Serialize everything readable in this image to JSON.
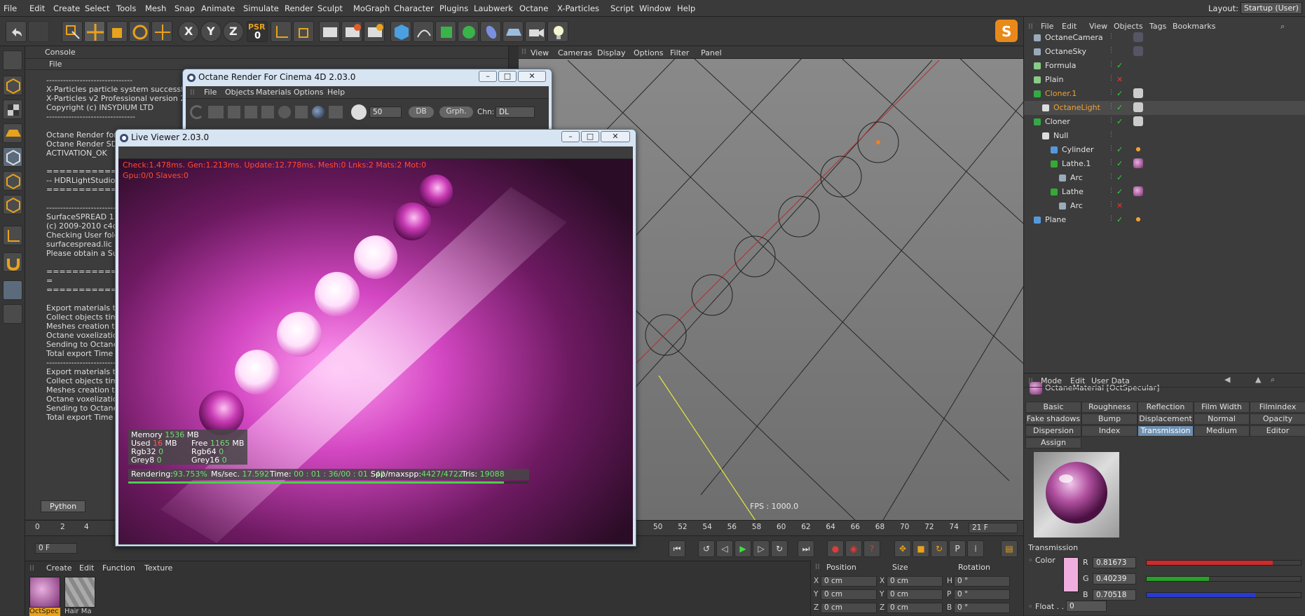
{
  "menubar": {
    "items": [
      "File",
      "Edit",
      "Create",
      "Select",
      "Tools",
      "Mesh",
      "Snap",
      "Animate",
      "Simulate",
      "Render",
      "Sculpt",
      "MoGraph",
      "Character",
      "Plugins",
      "Laubwerk",
      "Octane",
      "X-Particles",
      "Script",
      "Window",
      "Help"
    ],
    "layout_label": "Layout:",
    "layout_value": "Startup (User)"
  },
  "toolbar": {
    "x_label": "X",
    "y_label": "Y",
    "z_label": "Z",
    "psr_label": "PSR",
    "psr_value": "0"
  },
  "console": {
    "title": "Console",
    "file_menu": "File",
    "log": "-------------------------------\nX-Particles particle system successfully\nX-Particles v2 Professional version 2.5\nCopyright (c) INSYDIUM LTD\n--------------------------------\n\nOctane Render for\nOctane Render SD\nACTIVATION_OK\n\n================\n-- HDRLightStudio\n================\n\n--------------------------------\nSurfaceSPREAD 1.0\n(c) 2009-2010 c4d-\nChecking User fold\nsurfacespread.lic c\nPlease obtain a Su\n\n================\n=\n================\n\nExport materials tim\nCollect objects tim\nMeshes creation ti\nOctane voxelizatio\nSending to Octane\nTotal export Time =\n--------------------------------\nExport materials tim\nCollect objects tim\nMeshes creation ti\nOctane voxelizatio\nSending to Octane\nTotal export Time =",
    "python_button": "Python"
  },
  "octane_window": {
    "title": "Octane Render For Cinema 4D 2.03.0",
    "menu": [
      "File",
      "Objects",
      "Materials",
      "Options",
      "Help"
    ],
    "spp_value": "50",
    "db_button": "DB",
    "graph_button": "Grph.",
    "channel_label": "Chn:",
    "channel_value": "DL"
  },
  "live_viewer": {
    "title": "Live Viewer 2.03.0",
    "status_line1": "Check:1.478ms. Gen:1.213ms. Update:12.778ms. Mesh:0 Lnks:2 Mats:2 Mot:0",
    "status_line2": "Gpu:0/0 Slaves:0",
    "memory_label": "Memory",
    "memory_value": "1536",
    "memory_unit": "MB",
    "used_label": "Used",
    "used_value": "16",
    "used_unit": "MB",
    "free_label": "Free",
    "free_value": "1165",
    "free_unit": "MB",
    "rgb32_label": "Rgb32",
    "rgb32_value": "0",
    "rgb64_label": "Rgb64",
    "rgb64_value": "0",
    "grey8_label": "Grey8",
    "grey8_value": "0",
    "grey16_label": "Grey16",
    "grey16_value": "0",
    "rendering_label": "Rendering:",
    "rendering_value": "93.753%",
    "mssec_label": "Ms/sec.",
    "mssec_value": "17.592",
    "time_label": "Time:",
    "time_value": "00 : 01 : 36/00 : 01 : 42",
    "spp_label": "Spp/maxspp:",
    "spp_value": "4427/4722",
    "tris_label": "Tris:",
    "tris_value": "19088",
    "progress": 0.9375
  },
  "viewport": {
    "menu": [
      "View",
      "Cameras",
      "Display",
      "Options",
      "Filter",
      "Panel"
    ],
    "fps": "FPS : 1000.0"
  },
  "timeline": {
    "ticks_left": [
      "0",
      "2",
      "4"
    ],
    "ticks_right": [
      "50",
      "52",
      "54",
      "56",
      "58",
      "60",
      "62",
      "64",
      "66",
      "68",
      "70",
      "72",
      "74"
    ],
    "current_frame": "21 F",
    "start_field": "0 F",
    "start_field2": "0 F"
  },
  "material_manager": {
    "menu": [
      "Create",
      "Edit",
      "Function",
      "Texture"
    ],
    "materials": [
      "OctSpec",
      "Hair Ma"
    ]
  },
  "coordinates": {
    "headers": [
      "Position",
      "Size",
      "Rotation"
    ],
    "rows": [
      {
        "axis": "X",
        "pos": "0 cm",
        "saxis": "X",
        "size": "0 cm",
        "raxis": "H",
        "rot": "0 °"
      },
      {
        "axis": "Y",
        "pos": "0 cm",
        "saxis": "Y",
        "size": "0 cm",
        "raxis": "P",
        "rot": "0 °"
      },
      {
        "axis": "Z",
        "pos": "0 cm",
        "saxis": "Z",
        "size": "0 cm",
        "raxis": "B",
        "rot": "0 °"
      }
    ]
  },
  "object_manager": {
    "menu": [
      "File",
      "Edit",
      "View",
      "Objects",
      "Tags",
      "Bookmarks"
    ],
    "objects": [
      {
        "name": "OctaneCamera",
        "status": "none"
      },
      {
        "name": "OctaneSky",
        "status": "none"
      },
      {
        "name": "Formula",
        "status": "check"
      },
      {
        "name": "Plain",
        "status": "cross"
      },
      {
        "name": "Cloner.1",
        "status": "check"
      },
      {
        "name": "OctaneLight",
        "status": "check"
      },
      {
        "name": "Cloner",
        "status": "check"
      },
      {
        "name": "Null",
        "status": "none"
      },
      {
        "name": "Cylinder",
        "status": "check"
      },
      {
        "name": "Lathe.1",
        "status": "check"
      },
      {
        "name": "Arc",
        "status": "check"
      },
      {
        "name": "Lathe",
        "status": "check"
      },
      {
        "name": "Arc",
        "status": "cross"
      },
      {
        "name": "Plane",
        "status": "check"
      }
    ]
  },
  "attribute_manager": {
    "menu": [
      "Mode",
      "Edit",
      "User Data"
    ],
    "material_title": "OctaneMaterial [OctSpecular]",
    "tabs_row1": [
      "Basic",
      "Roughness",
      "Reflection",
      "Film Width",
      "Filmindex"
    ],
    "tabs_row2": [
      "Fake shadows",
      "Bump",
      "Displacement",
      "Normal",
      "Opacity"
    ],
    "tabs_row3": [
      "Dispersion",
      "Index",
      "Transmission",
      "Medium",
      "Editor"
    ],
    "tabs_row4": [
      "Assign"
    ],
    "active_tab": "Transmission",
    "section_title": "Transmission",
    "color_label": "Color",
    "r_label": "R",
    "r_value": "0.81673",
    "g_label": "G",
    "g_value": "0.40239",
    "b_label": "B",
    "b_value": "0.70518",
    "r_level": 0.81673,
    "g_level": 0.40239,
    "b_level": 0.70518,
    "float_label": "Float",
    "float_value": "0",
    "swatch_color": "#f0aee0"
  }
}
